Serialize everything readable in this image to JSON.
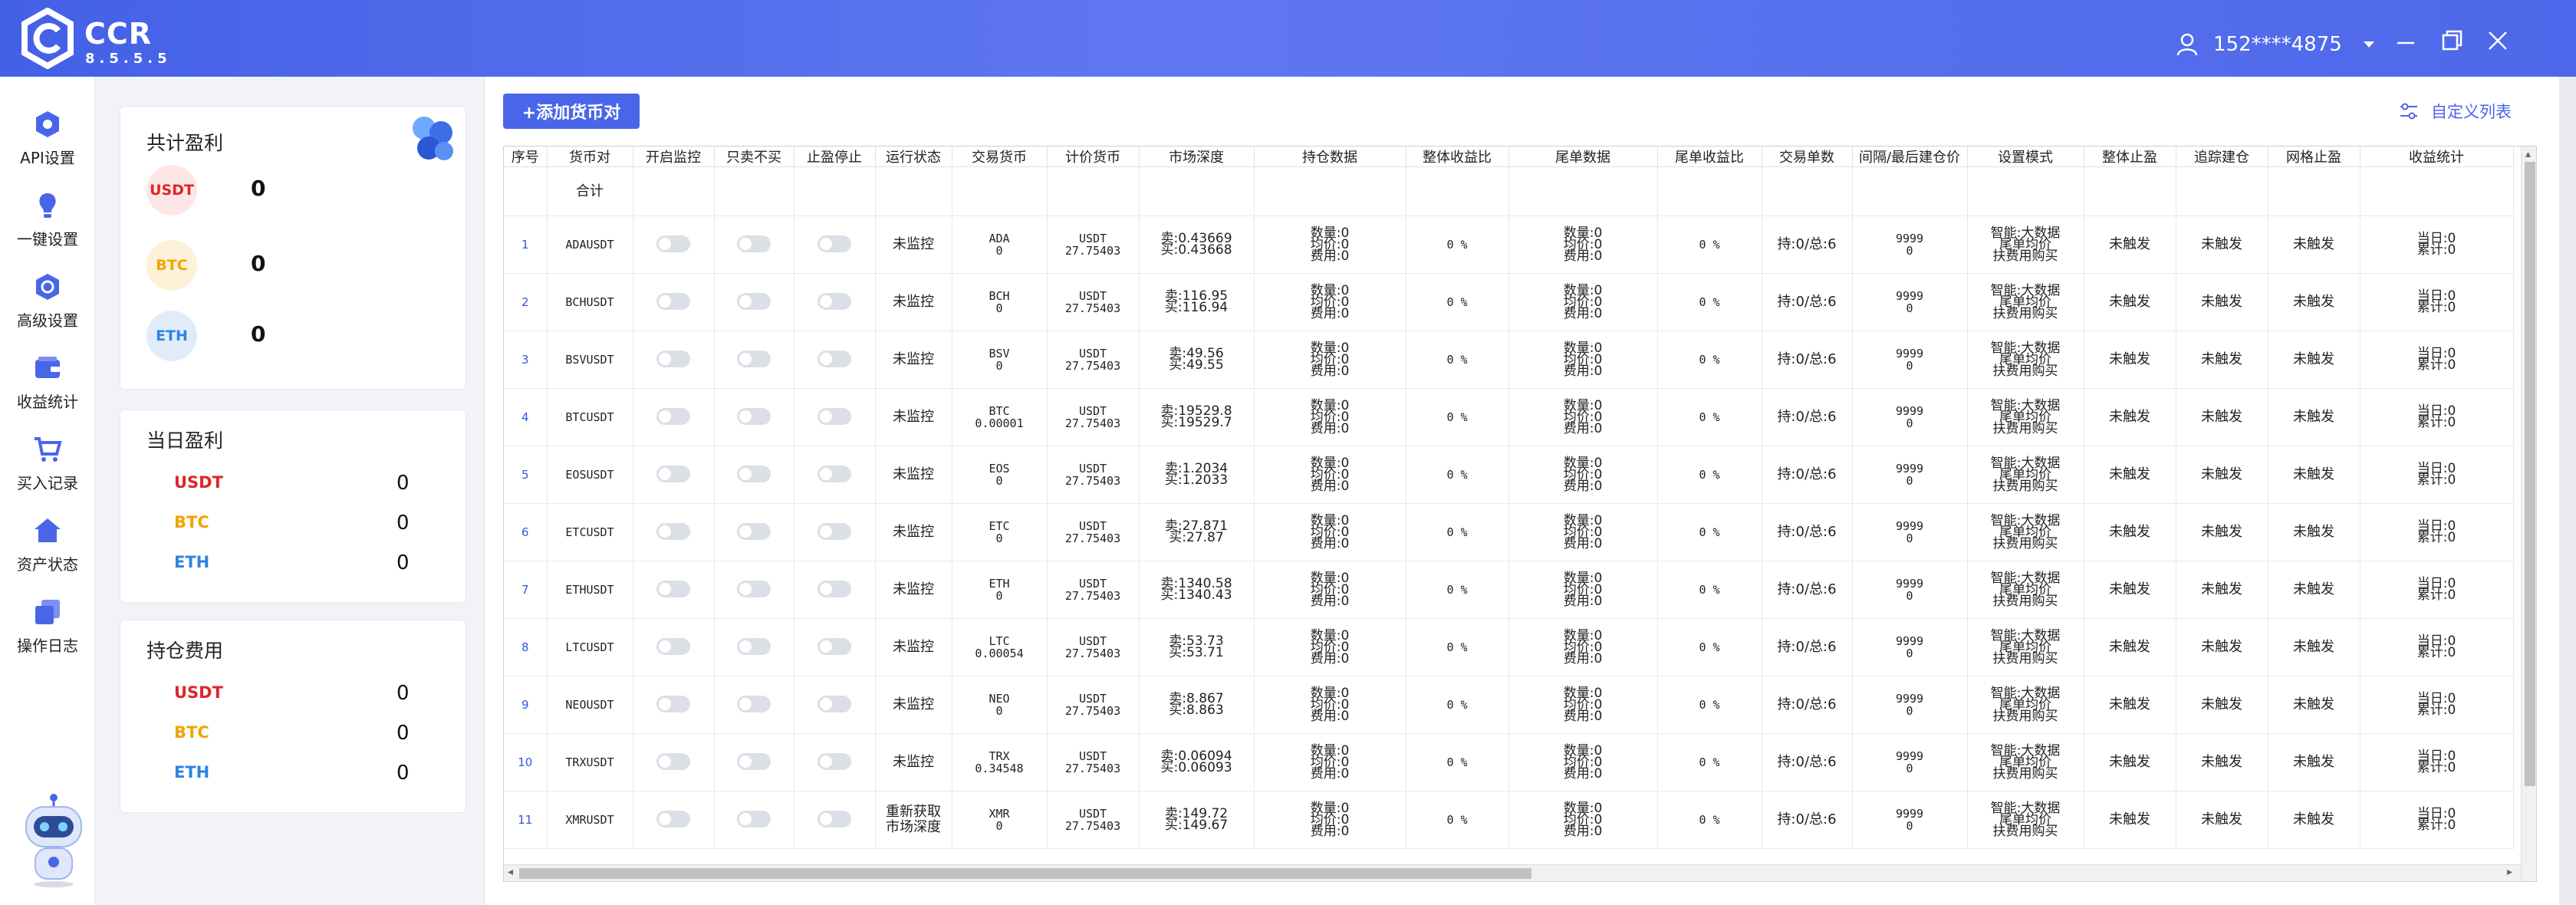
{
  "app": {
    "name": "CCR",
    "version": "8.5.5.5",
    "user": "152****4875"
  },
  "colors": {
    "accent": "#4a66e8",
    "usdt": "#e0242a",
    "btc": "#f2a400",
    "eth": "#2c84e4"
  },
  "nav": [
    {
      "label": "API设置",
      "icon": "api-icon"
    },
    {
      "label": "一键设置",
      "icon": "bulb-icon"
    },
    {
      "label": "高级设置",
      "icon": "gear-icon"
    },
    {
      "label": "收益统计",
      "icon": "wallet-icon"
    },
    {
      "label": "买入记录",
      "icon": "cart-icon"
    },
    {
      "label": "资产状态",
      "icon": "house-icon"
    },
    {
      "label": "操作日志",
      "icon": "log-icon"
    }
  ],
  "stats": {
    "total": {
      "title": "共计盈利",
      "items": [
        {
          "coin": "USDT",
          "value": "0"
        },
        {
          "coin": "BTC",
          "value": "0"
        },
        {
          "coin": "ETH",
          "value": "0"
        }
      ]
    },
    "today": {
      "title": "当日盈利",
      "items": [
        {
          "coin": "USDT",
          "value": "0"
        },
        {
          "coin": "BTC",
          "value": "0"
        },
        {
          "coin": "ETH",
          "value": "0"
        }
      ]
    },
    "fees": {
      "title": "持仓费用",
      "items": [
        {
          "coin": "USDT",
          "value": "0"
        },
        {
          "coin": "BTC",
          "value": "0"
        },
        {
          "coin": "ETH",
          "value": "0"
        }
      ]
    }
  },
  "toolbar": {
    "add_pair": "+添加货币对",
    "custom_list": "自定义列表"
  },
  "table": {
    "headers": [
      "序号",
      "货币对",
      "开启监控",
      "只卖不买",
      "止盈停止",
      "运行状态",
      "交易货币",
      "计价货币",
      "市场深度",
      "持仓数据",
      "整体收益比",
      "尾单数据",
      "尾单收益比",
      "交易单数",
      "间隔/最后建仓价",
      "设置模式",
      "整体止盈",
      "追踪建仓",
      "网格止盈",
      "收益统计"
    ],
    "sum_label": "合计",
    "rows": [
      {
        "idx": "1",
        "pair": "ADAUSDT",
        "state": "未监控",
        "trade": [
          "ADA",
          "0"
        ],
        "quote": [
          "USDT",
          "27.75403"
        ],
        "depth": [
          "卖:0.43669",
          "买:0.43668"
        ]
      },
      {
        "idx": "2",
        "pair": "BCHUSDT",
        "state": "未监控",
        "trade": [
          "BCH",
          "0"
        ],
        "quote": [
          "USDT",
          "27.75403"
        ],
        "depth": [
          "卖:116.95",
          "买:116.94"
        ]
      },
      {
        "idx": "3",
        "pair": "BSVUSDT",
        "state": "未监控",
        "trade": [
          "BSV",
          "0"
        ],
        "quote": [
          "USDT",
          "27.75403"
        ],
        "depth": [
          "卖:49.56",
          "买:49.55"
        ]
      },
      {
        "idx": "4",
        "pair": "BTCUSDT",
        "state": "未监控",
        "trade": [
          "BTC",
          "0.00001"
        ],
        "quote": [
          "USDT",
          "27.75403"
        ],
        "depth": [
          "卖:19529.8",
          "买:19529.7"
        ]
      },
      {
        "idx": "5",
        "pair": "EOSUSDT",
        "state": "未监控",
        "trade": [
          "EOS",
          "0"
        ],
        "quote": [
          "USDT",
          "27.75403"
        ],
        "depth": [
          "卖:1.2034",
          "买:1.2033"
        ]
      },
      {
        "idx": "6",
        "pair": "ETCUSDT",
        "state": "未监控",
        "trade": [
          "ETC",
          "0"
        ],
        "quote": [
          "USDT",
          "27.75403"
        ],
        "depth": [
          "卖:27.871",
          "买:27.87"
        ]
      },
      {
        "idx": "7",
        "pair": "ETHUSDT",
        "state": "未监控",
        "trade": [
          "ETH",
          "0"
        ],
        "quote": [
          "USDT",
          "27.75403"
        ],
        "depth": [
          "卖:1340.58",
          "买:1340.43"
        ]
      },
      {
        "idx": "8",
        "pair": "LTCUSDT",
        "state": "未监控",
        "trade": [
          "LTC",
          "0.00054"
        ],
        "quote": [
          "USDT",
          "27.75403"
        ],
        "depth": [
          "卖:53.73",
          "买:53.71"
        ]
      },
      {
        "idx": "9",
        "pair": "NEOUSDT",
        "state": "未监控",
        "trade": [
          "NEO",
          "0"
        ],
        "quote": [
          "USDT",
          "27.75403"
        ],
        "depth": [
          "卖:8.867",
          "买:8.863"
        ]
      },
      {
        "idx": "10",
        "pair": "TRXUSDT",
        "state": "未监控",
        "trade": [
          "TRX",
          "0.34548"
        ],
        "quote": [
          "USDT",
          "27.75403"
        ],
        "depth": [
          "卖:0.06094",
          "买:0.06093"
        ]
      },
      {
        "idx": "11",
        "pair": "XMRUSDT",
        "state": "重新获取\n市场深度",
        "trade": [
          "XMR",
          "0"
        ],
        "quote": [
          "USDT",
          "27.75403"
        ],
        "depth": [
          "卖:149.72",
          "买:149.67"
        ]
      }
    ],
    "common": {
      "position": [
        "数量:0",
        "均价:0",
        "费用:0"
      ],
      "ratio": "0 %",
      "tail": [
        "数量:0",
        "均价:0",
        "费用:0"
      ],
      "tail_ratio": "0 %",
      "orders": "持:0/总:6",
      "interval": [
        "9999",
        "0"
      ],
      "mode": [
        "智能:大数据",
        "尾单均价",
        "扶费用购买"
      ],
      "tp": "未触发",
      "track": "未触发",
      "grid": "未触发",
      "profit": [
        "当日:0",
        "累计:0"
      ]
    }
  }
}
